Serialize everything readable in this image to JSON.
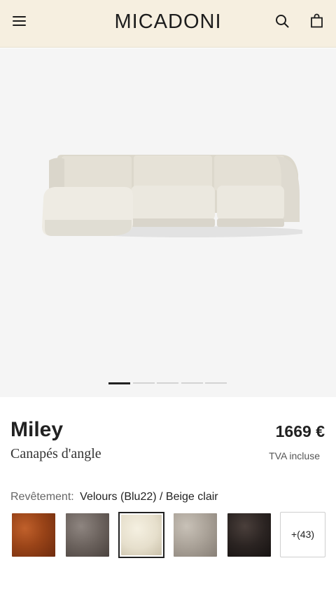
{
  "header": {
    "logo": "MICADONI",
    "menu_icon": "hamburger-menu-icon",
    "search_icon": "search-icon",
    "bag_icon": "shopping-bag-icon"
  },
  "gallery": {
    "image": "corner-sofa-product-image",
    "slides_total": 5,
    "active_slide": 1
  },
  "product": {
    "name": "Miley",
    "category": "Canapés d'angle",
    "price": "1669 €",
    "tax_note": "TVA incluse",
    "cover_label": "Revêtement:",
    "cover_value": "Velours (Blu22) / Beige clair",
    "swatches": [
      {
        "name": "rust-velvet",
        "color": "#9a4418",
        "selected": false
      },
      {
        "name": "taupe-grey-velvet",
        "color": "#6b625d",
        "selected": false
      },
      {
        "name": "light-beige-velvet",
        "color": "#e6dfcc",
        "selected": true
      },
      {
        "name": "warm-grey-velvet",
        "color": "#a9a197",
        "selected": false
      },
      {
        "name": "dark-brown-velvet",
        "color": "#2b2422",
        "selected": false
      }
    ],
    "more_label": "+(43)"
  },
  "colors": {
    "header_bg": "#f6efe0",
    "hero_bg": "#f5f5f5",
    "sofa": "#e9e6dc"
  }
}
